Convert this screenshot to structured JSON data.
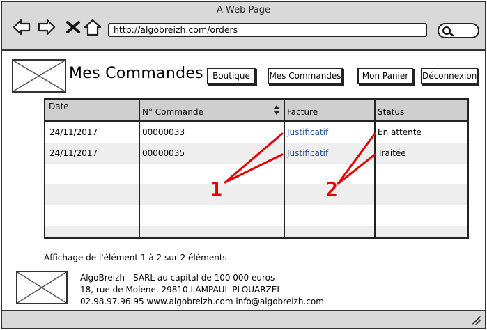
{
  "window": {
    "title": "A Web Page"
  },
  "browser": {
    "url": "http://algobreizh.com/orders",
    "buttons": [
      "back-icon",
      "forward-icon",
      "close-icon",
      "home-icon"
    ],
    "search_icon": "search-icon"
  },
  "header": {
    "title": "Mes Commandes",
    "nav": [
      "Boutique",
      "Mes Commandes",
      "Mon Panier",
      "Déconnexion"
    ]
  },
  "table": {
    "columns": [
      "Date",
      "N° Commande",
      "Facture",
      "Status"
    ],
    "sort_icon": "sort-icon",
    "rows": [
      {
        "date": "24/11/2017",
        "number": "00000033",
        "invoice": "Justificatif",
        "status": "En attente"
      },
      {
        "date": "24/11/2017",
        "number": "00000035",
        "invoice": "Justificatif",
        "status": "Traitée"
      }
    ]
  },
  "pager": {
    "info": "Affichage de l'élément 1 à 2 sur 2 éléments"
  },
  "footer": {
    "line1": "AlgoBreizh - SARL au capital de 100 000 euros",
    "line2": "18, rue de Molene, 29810 LAMPAUL-PLOUARZEL",
    "line3": "02.98.97.96.95 www.algobreizh.com info@algobreizh.com"
  },
  "annotations": {
    "one": "1",
    "two": "2",
    "color": "#e60000"
  }
}
